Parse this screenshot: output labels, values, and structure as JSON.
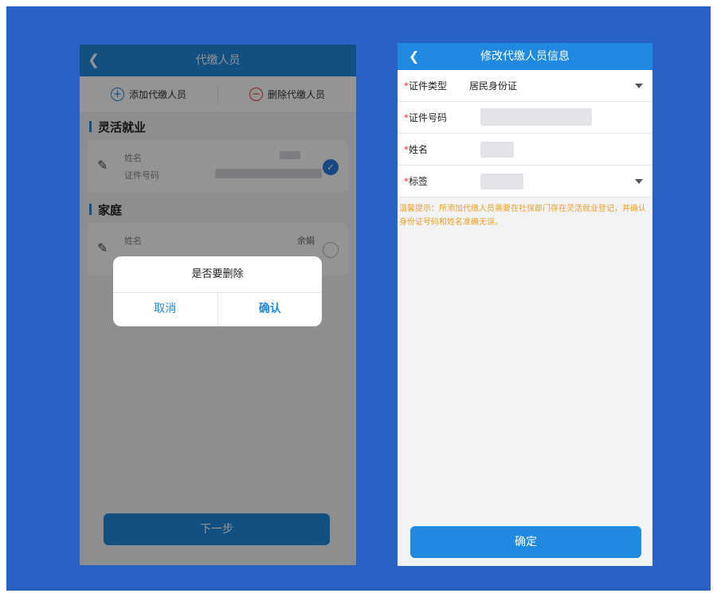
{
  "left": {
    "back_icon": "chevron-left-icon",
    "title": "代缴人员",
    "actions": {
      "add_label": "添加代缴人员",
      "delete_label": "删除代缴人员"
    },
    "sections": [
      {
        "title": "灵活就业",
        "card": {
          "name_label": "姓名",
          "id_label": "证件号码",
          "name_value": "",
          "selected": true
        }
      },
      {
        "title": "家庭",
        "card": {
          "name_label": "姓名",
          "name_value": "余娟",
          "selected": false
        }
      }
    ],
    "dialog": {
      "title": "是否要删除",
      "cancel_label": "取消",
      "confirm_label": "确认"
    },
    "next_label": "下一步"
  },
  "right": {
    "back_icon": "chevron-left-icon",
    "title": "修改代缴人员信息",
    "fields": [
      {
        "required_mark": "*",
        "label": "证件类型",
        "value": "居民身份证",
        "dropdown": true
      },
      {
        "required_mark": "*",
        "label": "证件号码",
        "value": "",
        "dropdown": false
      },
      {
        "required_mark": "*",
        "label": "姓名",
        "value": "",
        "dropdown": false
      },
      {
        "required_mark": "*",
        "label": "标签",
        "value": "",
        "dropdown": true
      }
    ],
    "tip": "温馨提示：所添加代缴人员需要在社保部门存在灵活就业登记，并确认身份证号码和姓名准确无误。",
    "confirm_label": "确定"
  },
  "colors": {
    "background": "#2962c4",
    "primary": "#1f8ae0",
    "danger": "#e53935",
    "warning_text": "#f0a020"
  }
}
